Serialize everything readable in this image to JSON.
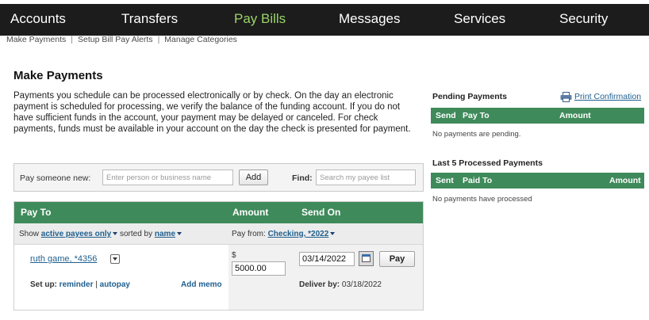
{
  "nav": {
    "items": [
      {
        "label": "Accounts",
        "active": false
      },
      {
        "label": "Transfers",
        "active": false
      },
      {
        "label": "Pay Bills",
        "active": true
      },
      {
        "label": "Messages",
        "active": false
      },
      {
        "label": "Services",
        "active": false
      },
      {
        "label": "Security",
        "active": false
      }
    ]
  },
  "subnav": {
    "items": [
      "Make Payments",
      "Setup Bill Pay Alerts",
      "Manage Categories"
    ],
    "separator": "|"
  },
  "page": {
    "title": "Make Payments",
    "intro": "Payments you schedule can be processed electronically or by check. On the day an electronic payment is scheduled for processing, we verify the balance of the funding account. If you do not have sufficient funds in the account, your payment may be delayed or canceled. For check payments, funds must be available in your account on the day the check is presented for payment."
  },
  "pay_new": {
    "label": "Pay someone new:",
    "placeholder": "Enter person or business name",
    "add_label": "Add",
    "find_label": "Find:",
    "find_placeholder": "Search my payee list"
  },
  "payee_table": {
    "headers": {
      "pay_to": "Pay To",
      "amount": "Amount",
      "send_on": "Send On"
    },
    "filter": {
      "show": "Show",
      "active_filter": "active payees only",
      "sorted_by": "sorted by",
      "sort_field": "name",
      "pay_from": "Pay from:",
      "account": "Checking, *2022"
    },
    "rows": [
      {
        "payee": "ruth game, *4356",
        "setup_label": "Set up:",
        "reminder": "reminder",
        "pipe": "|",
        "autopay": "autopay",
        "add_memo": "Add memo",
        "currency": "$",
        "amount": "5000.00",
        "send_on": "03/14/2022",
        "pay_button": "Pay",
        "deliver_label": "Deliver by:",
        "deliver_date": "03/18/2022"
      }
    ]
  },
  "pending": {
    "title": "Pending Payments",
    "print_label": "Print Confirmation",
    "headers": {
      "send": "Send",
      "pay_to": "Pay To",
      "amount": "Amount"
    },
    "empty": "No payments are pending."
  },
  "processed": {
    "title": "Last 5 Processed Payments",
    "headers": {
      "sent": "Sent",
      "paid_to": "Paid To",
      "amount": "Amount"
    },
    "empty": "No payments have processed"
  },
  "colors": {
    "nav_bg": "#1c1c1c",
    "nav_active": "#9bd36a",
    "table_header": "#3f8a5b",
    "link": "#1f5f8f"
  }
}
